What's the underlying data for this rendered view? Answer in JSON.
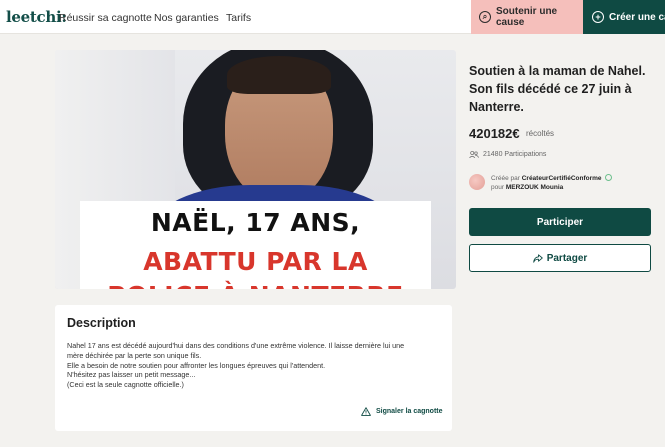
{
  "header": {
    "logo": "leetchi:",
    "nav": [
      "Réussir sa cagnotte",
      "Nos garanties",
      "Tarifs"
    ],
    "support_button": "Soutenir une cause",
    "create_button": "Créer une cagnotte"
  },
  "hero": {
    "caption_line1": "NAËL, 17 ANS,",
    "caption_line2": "ABATTU PAR LA",
    "caption_line3": "POLICE À NANTERRE",
    "caption_colors": {
      "line1": "#111111",
      "line2": "#d8362c"
    }
  },
  "campaign": {
    "title": "Soutien à la maman de Nahel. Son fils décédé ce 27 juin à Nanterre.",
    "amount": "420182€",
    "amount_label": "récoltés",
    "participants": "21480 Participations",
    "created_by_prefix": "Créée par",
    "creator_badge": "CréateurCertifiéConforme",
    "for_prefix": "pour",
    "beneficiary": "MERZOUK Mounia",
    "participate_button": "Participer",
    "share_button": "Partager"
  },
  "description": {
    "heading": "Description",
    "lines": [
      "Nahel 17 ans est décédé aujourd'hui dans des conditions d'une extrême violence. Il laisse dernière lui une",
      "mère déchirée par la perte son unique fils.",
      "Elle a besoin de notre soutien pour affronter les longues épreuves qui l'attendent.",
      "N'hésitez pas laisser un petit message...",
      "(Ceci est la seule cagnotte officielle.)"
    ],
    "report_link": "Signaler la cagnotte"
  },
  "colors": {
    "brand": "#0f4a43",
    "support_bg": "#f5bfbb",
    "page_bg": "#f3f2ef"
  }
}
